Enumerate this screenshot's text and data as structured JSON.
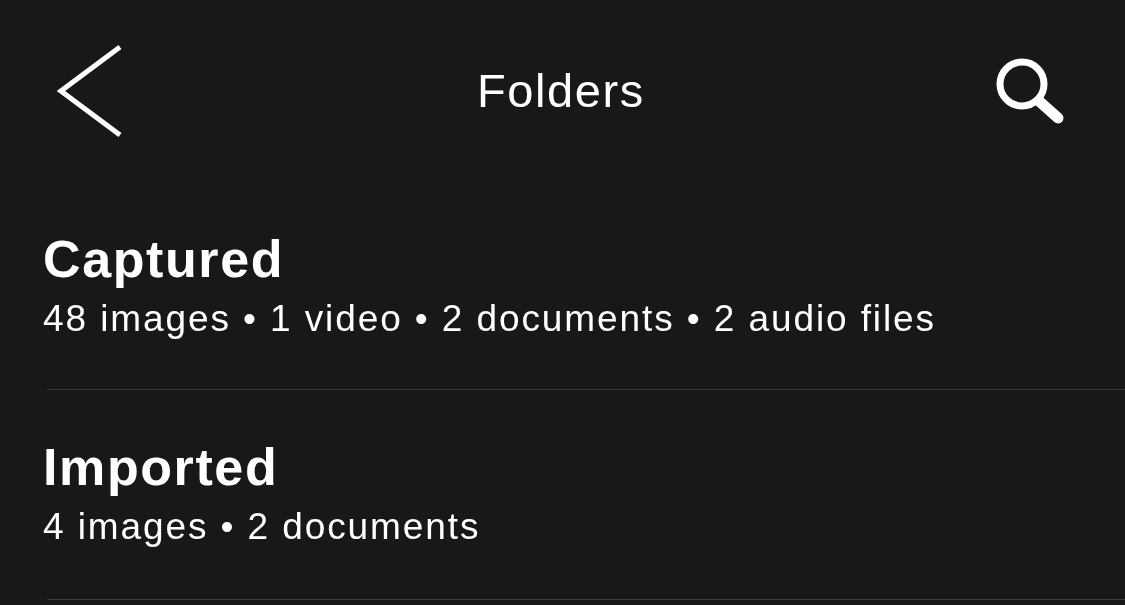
{
  "nav_bar": {
    "title": "Folders"
  },
  "folders": [
    {
      "name": "Captured",
      "summary": "48 images • 1 video • 2 documents • 2 audio files"
    },
    {
      "name": "Imported",
      "summary": "4 images • 2 documents"
    }
  ]
}
